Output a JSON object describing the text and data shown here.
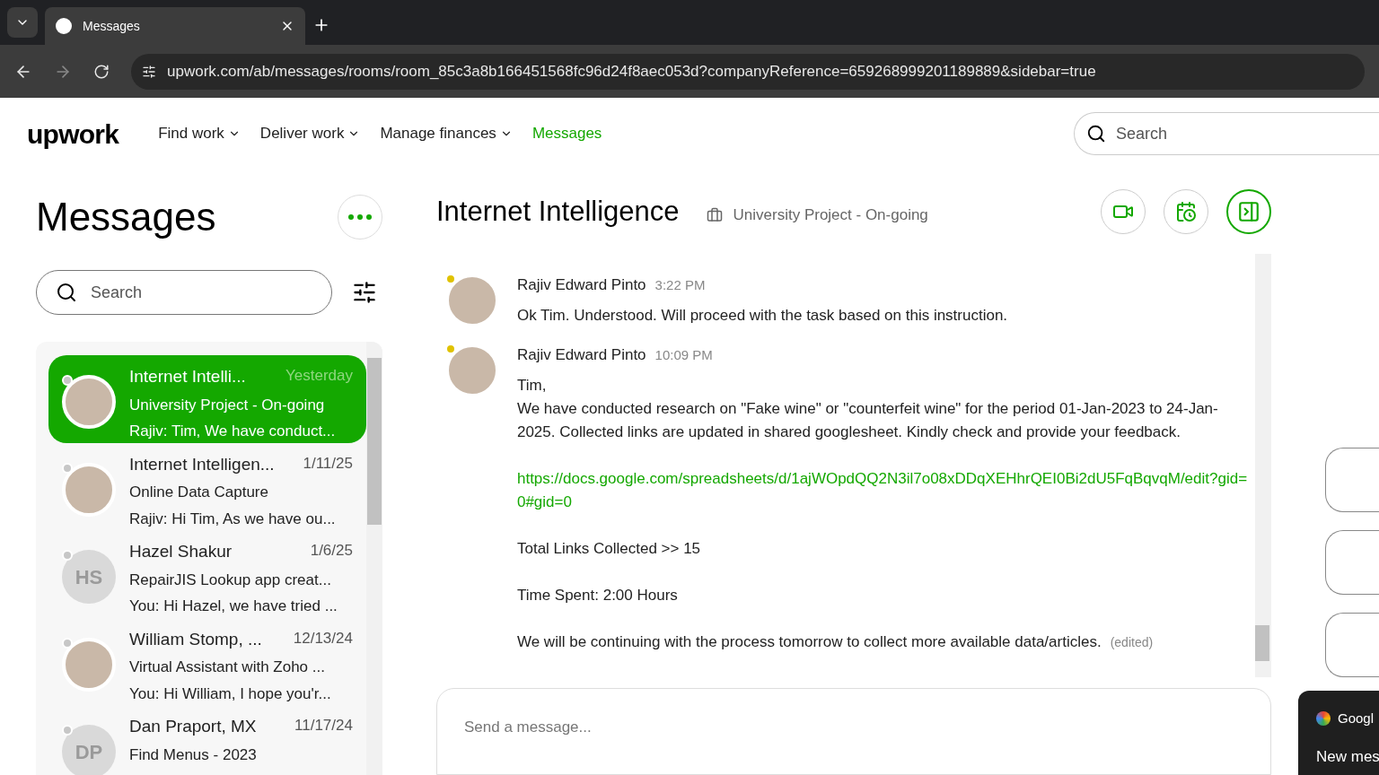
{
  "browser": {
    "tab_title": "Messages",
    "url": "upwork.com/ab/messages/rooms/room_85c3a8b166451568fc96d24f8aec053d?companyReference=659268999201189889&sidebar=true"
  },
  "nav": {
    "logo": "upwork",
    "items": [
      {
        "label": "Find work",
        "dropdown": true,
        "selected": false
      },
      {
        "label": "Deliver work",
        "dropdown": true,
        "selected": false
      },
      {
        "label": "Manage finances",
        "dropdown": true,
        "selected": false
      },
      {
        "label": "Messages",
        "dropdown": false,
        "selected": true
      }
    ],
    "search": {
      "placeholder": "Search"
    }
  },
  "sidebar": {
    "title": "Messages",
    "search": {
      "placeholder": "Search"
    },
    "conversations": [
      {
        "name": "Internet Intelli...",
        "date": "Yesterday",
        "subject": "University Project - On-going",
        "preview": "Rajiv: Tim, We have conduct...",
        "avatar": {
          "kind": "photo"
        },
        "selected": true
      },
      {
        "name": "Internet Intelligen...",
        "date": "1/11/25",
        "subject": "Online Data Capture",
        "preview": "Rajiv: Hi Tim, As we have ou...",
        "avatar": {
          "kind": "photo"
        },
        "selected": false
      },
      {
        "name": "Hazel Shakur",
        "date": "1/6/25",
        "subject": "RepairJIS Lookup app creat...",
        "preview": "You: Hi Hazel, we have tried ...",
        "avatar": {
          "kind": "initials",
          "initials": "HS"
        },
        "selected": false
      },
      {
        "name": "William Stomp, ...",
        "date": "12/13/24",
        "subject": "Virtual Assistant with Zoho ...",
        "preview": "You: Hi William, I hope you'r...",
        "avatar": {
          "kind": "photo"
        },
        "selected": false
      },
      {
        "name": "Dan Praport, MX",
        "date": "11/17/24",
        "subject": "Find Menus - 2023",
        "avatar": {
          "kind": "initials",
          "initials": "DP"
        },
        "selected": false
      }
    ]
  },
  "chat": {
    "title": "Internet Intelligence",
    "project": "University Project - On-going",
    "messages": [
      {
        "author": "Rajiv Edward Pinto",
        "time": "3:22 PM",
        "paragraphs": [
          {
            "kind": "text",
            "lines": [
              "Ok Tim. Understood. Will proceed with the task based on this instruction."
            ]
          }
        ]
      },
      {
        "author": "Rajiv Edward Pinto",
        "time": "10:09 PM",
        "edited_note": "(edited)",
        "paragraphs": [
          {
            "kind": "text",
            "lines": [
              "Tim,",
              "We have conducted research on \"Fake wine\" or \"counterfeit wine\" for the period 01-Jan-2023 to 24-Jan-2025. Collected links are updated in shared googlesheet. Kindly check and provide your feedback."
            ]
          },
          {
            "kind": "link",
            "lines": [
              "https://docs.google.com/spreadsheets/d/1ajWOpdQQ2N3il7o08xDDqXEHhrQEI0Bi2dU5FqBqvqM/edit?gid=0#gid=0"
            ]
          },
          {
            "kind": "text",
            "lines": [
              "Total Links Collected >> 15"
            ]
          },
          {
            "kind": "text",
            "lines": [
              "Time Spent: 2:00 Hours"
            ]
          },
          {
            "kind": "text",
            "lines": [
              "We will be continuing with the process tomorrow to collect more available data/articles."
            ]
          }
        ]
      }
    ],
    "composer": {
      "placeholder": "Send a message..."
    }
  },
  "notification": {
    "source": "Googl",
    "text": "New mes"
  }
}
